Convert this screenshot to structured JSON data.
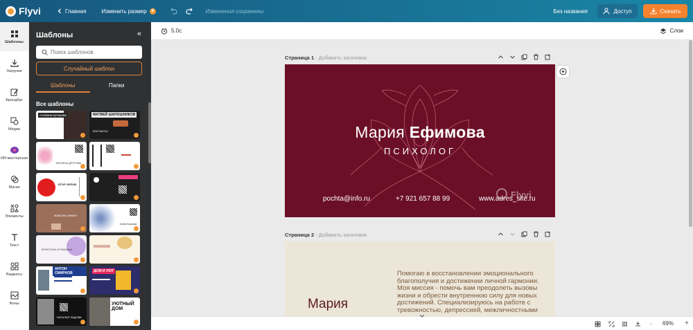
{
  "topbar": {
    "brand": "Flyvi",
    "home_label": "Главная",
    "resize_label": "Изменить размер",
    "saved_status": "Изменения сохранены",
    "doc_title": "Без названия",
    "access_label": "Доступ",
    "download_label": "Скачать"
  },
  "rail": {
    "items": [
      {
        "label": "Шаблоны",
        "icon": "grid-icon"
      },
      {
        "label": "Загрузки",
        "icon": "upload-icon"
      },
      {
        "label": "Брендбук",
        "icon": "edit-icon"
      },
      {
        "label": "Медиа",
        "icon": "media-icon"
      },
      {
        "label": "ИИ-мастерская",
        "icon": "ai-icon"
      },
      {
        "label": "Маски",
        "icon": "mask-icon"
      },
      {
        "label": "Элементы",
        "icon": "elements-icon"
      },
      {
        "label": "Текст",
        "icon": "text-icon"
      },
      {
        "label": "Виджеты",
        "icon": "widgets-icon"
      },
      {
        "label": "Фоны",
        "icon": "background-icon"
      }
    ]
  },
  "panel": {
    "title": "Шаблоны",
    "collapse": "«",
    "search_placeholder": "Поиск шаблонов",
    "random_label": "Случайный шаблон",
    "tabs": [
      "Шаблоны",
      "Папки"
    ],
    "section_title": "Все шаблоны"
  },
  "thumbs": [
    {
      "texts": [
        "Альбина Кучерова"
      ]
    },
    {
      "texts": [
        "МАТВЕЙ ШАПОШНИКОВ",
        "КОНТАКТЫ"
      ]
    },
    {
      "texts": [
        "ТАТЬЯНА ДРУГОВА"
      ]
    },
    {
      "texts": []
    },
    {
      "texts": [
        "ЕГОР ОРЛОВ"
      ]
    },
    {
      "texts": []
    },
    {
      "texts": [
        "МАКСИМ ЗИМИН"
      ]
    },
    {
      "texts": [
        "Анна Быкова"
      ]
    },
    {
      "texts": [
        "КРИСТИНА КУЗЬМИНА"
      ]
    },
    {
      "texts": []
    },
    {
      "texts": [
        "АНТОН СМИРНОВ"
      ]
    },
    {
      "texts": [
        "ДОМ И УЮТ"
      ]
    },
    {
      "texts": [
        "НАТАЛЬЯ ЛАДОВА"
      ]
    },
    {
      "texts": [
        "УЮТНЫЙ ДОМ"
      ]
    }
  ],
  "canvas": {
    "timer": "5.0с",
    "layers_label": "Слои",
    "page1": {
      "label": "Страница 1",
      "placeholder": "- Добавить заголовок"
    },
    "page2": {
      "label": "Страница 2",
      "placeholder": "- Добавить заголовок"
    },
    "zoom": "69%",
    "zoom_minus": "-",
    "zoom_plus": "+"
  },
  "card1": {
    "first_name": "Мария ",
    "last_name": "Ефимова",
    "profession": "ПСИХОЛОГ",
    "email": "pochta@info.ru",
    "phone": "+7 921 657 88 99",
    "site": "www.adres_site.ru",
    "watermark": "Flyvi",
    "bg_color": "#6b0f27"
  },
  "card2": {
    "about": "Помогаю в восстановлении эмоционального благополучия и достижении личной гармонии. Моя миссия - помочь вам преодолеть вызовы жизни и обрести внутреннюю силу для новых достижений. Специализируюсь на работе с тревожностью, депрессией, межличностными",
    "name": "Мария",
    "bg_color": "#ece6d9"
  },
  "colors": {
    "accent": "#f5822e",
    "topbar": "#17577e"
  }
}
